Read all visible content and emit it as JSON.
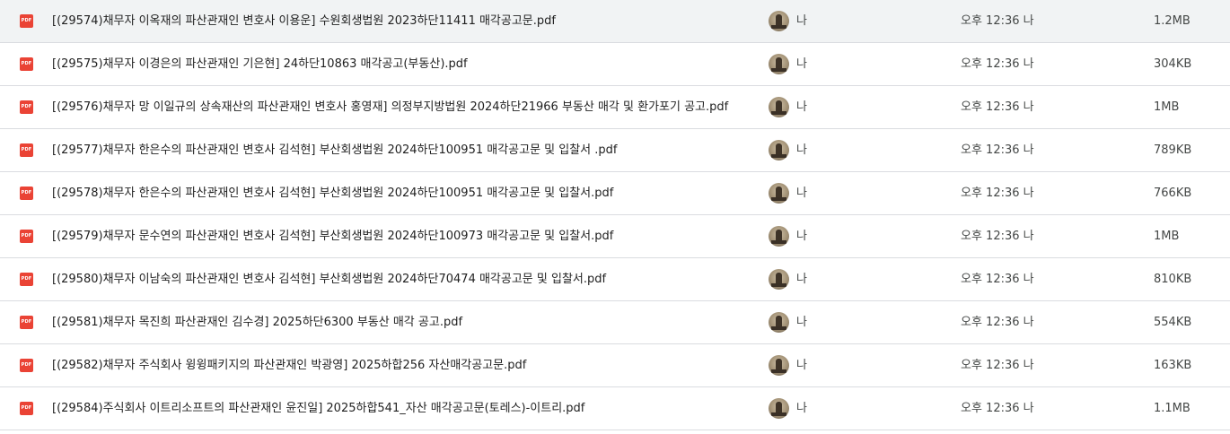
{
  "files": [
    {
      "name": "[(29574)채무자 이옥재의 파산관재인 변호사 이용운] 수원회생법원 2023하단11411 매각공고문.pdf",
      "owner": "나",
      "modified": "오후 12:36 나",
      "size": "1.2MB",
      "icon": "pdf-icon"
    },
    {
      "name": "[(29575)채무자 이경은의 파산관재인 기은현] 24하단10863 매각공고(부동산).pdf",
      "owner": "나",
      "modified": "오후 12:36 나",
      "size": "304KB",
      "icon": "pdf-icon"
    },
    {
      "name": "[(29576)채무자 망 이일규의 상속재산의 파산관재인 변호사 홍영재] 의정부지방법원 2024하단21966 부동산 매각 및 환가포기 공고.pdf",
      "owner": "나",
      "modified": "오후 12:36 나",
      "size": "1MB",
      "icon": "pdf-icon"
    },
    {
      "name": "[(29577)채무자 한은수의 파산관재인 변호사 김석현] 부산회생법원 2024하단100951 매각공고문 및 입찰서 .pdf",
      "owner": "나",
      "modified": "오후 12:36 나",
      "size": "789KB",
      "icon": "pdf-icon"
    },
    {
      "name": "[(29578)채무자 한은수의 파산관재인 변호사 김석현] 부산회생법원 2024하단100951 매각공고문 및 입찰서.pdf",
      "owner": "나",
      "modified": "오후 12:36 나",
      "size": "766KB",
      "icon": "pdf-icon"
    },
    {
      "name": "[(29579)채무자 문수연의 파산관재인 변호사 김석현] 부산회생법원 2024하단100973 매각공고문 및 입찰서.pdf",
      "owner": "나",
      "modified": "오후 12:36 나",
      "size": "1MB",
      "icon": "pdf-icon"
    },
    {
      "name": "[(29580)채무자 이남숙의 파산관재인 변호사 김석현] 부산회생법원 2024하단70474 매각공고문 및 입찰서.pdf",
      "owner": "나",
      "modified": "오후 12:36 나",
      "size": "810KB",
      "icon": "pdf-icon"
    },
    {
      "name": "[(29581)채무자 목진희 파산관재인 김수경] 2025하단6300 부동산 매각 공고.pdf",
      "owner": "나",
      "modified": "오후 12:36 나",
      "size": "554KB",
      "icon": "pdf-icon"
    },
    {
      "name": "[(29582)채무자 주식회사 윙윙패키지의 파산관재인 박광영] 2025하합256 자산매각공고문.pdf",
      "owner": "나",
      "modified": "오후 12:36 나",
      "size": "163KB",
      "icon": "pdf-icon"
    },
    {
      "name": "[(29584)주식회사 이트리소프트의 파산관재인 윤진일] 2025하합541_자산 매각공고문(토레스)-이트리.pdf",
      "owner": "나",
      "modified": "오후 12:36 나",
      "size": "1.1MB",
      "icon": "pdf-icon"
    }
  ],
  "icon_label": "PDF",
  "colors": {
    "pdf": "#ea4335",
    "divider": "#dadce0",
    "text": "#1f1f1f",
    "secondary": "#444746"
  }
}
